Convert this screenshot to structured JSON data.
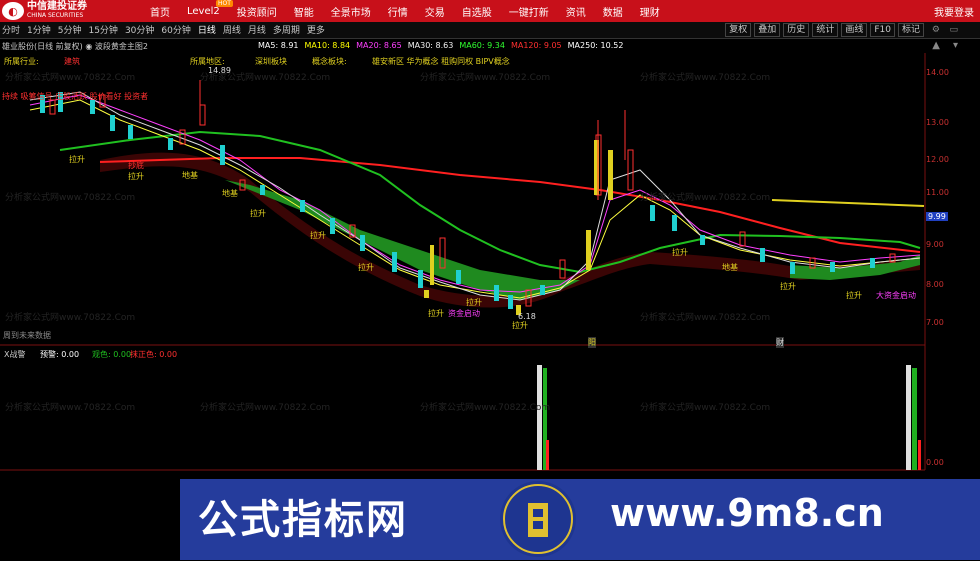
{
  "app": {
    "logo_cn": "中信建投证券",
    "logo_en": "CHINA SECURITIES",
    "login": "我要登录",
    "menu": [
      "首页",
      "Level2",
      "投资顾问",
      "智能",
      "全景市场",
      "行情",
      "交易",
      "自选股",
      "一键打新",
      "资讯",
      "数据",
      "理财"
    ],
    "hot_badge": "HOT"
  },
  "periods": [
    "分时",
    "1分钟",
    "5分钟",
    "15分钟",
    "30分钟",
    "60分钟",
    "日线",
    "周线",
    "月线",
    "多周期",
    "更多"
  ],
  "tools": [
    "复权",
    "叠加",
    "历史",
    "统计",
    "画线",
    "F10",
    "标记"
  ],
  "header": {
    "stock": "雄业股份(日线 前复权)",
    "indicator": "波段黄金主图2",
    "ma": [
      {
        "label": "MA5: 8.91",
        "color": "#ffffff"
      },
      {
        "label": "MA10: 8.84",
        "color": "#ffff00"
      },
      {
        "label": "MA20: 8.65",
        "color": "#ff00ff"
      },
      {
        "label": "MA30: 8.63",
        "color": "#00ff00"
      },
      {
        "label": "MA60: 9.34",
        "color": "#00ff00"
      },
      {
        "label": "MA120: 9.05",
        "color": "#ff3030"
      },
      {
        "label": "MA250: 10.52",
        "color": "#ffffff"
      }
    ]
  },
  "info": {
    "industry_label": "所属行业:",
    "industry": "建筑",
    "region_label": "所属地区:",
    "region": "深圳板块",
    "concept_label": "概念板块:",
    "concepts": "雄安新区 华为概念 租购同权 BIPV概念"
  },
  "annotations": {
    "top_red": "持续 吸筹信号 庄股活跃 股价看好 投资者",
    "high": "14.89",
    "low": "6.18",
    "diji": "地基",
    "lasheng": "拉升",
    "zijin": "资金启动",
    "dazijin": "大资金启动",
    "chuxian": "抄底",
    "weilai": "周到未来数据",
    "marker1": "阳",
    "marker2": "财"
  },
  "lower": {
    "title": "X战警",
    "v1": "预警: 0.00",
    "v2": "观色: 0.00",
    "v3": "抹正色: 0.00",
    "y_bottom": "0.00"
  },
  "right_axis": [
    "14.00",
    "13.00",
    "12.00",
    "11.00",
    "10.00",
    "9.99",
    "9.00",
    "8.00",
    "7.00"
  ],
  "banner": {
    "cn": "公式指标网",
    "url": "www.9m8.cn"
  },
  "watermark": "分析家公式网www.70822.Com",
  "colors": {
    "brand": "#c8101a",
    "banner": "#253c9c"
  }
}
